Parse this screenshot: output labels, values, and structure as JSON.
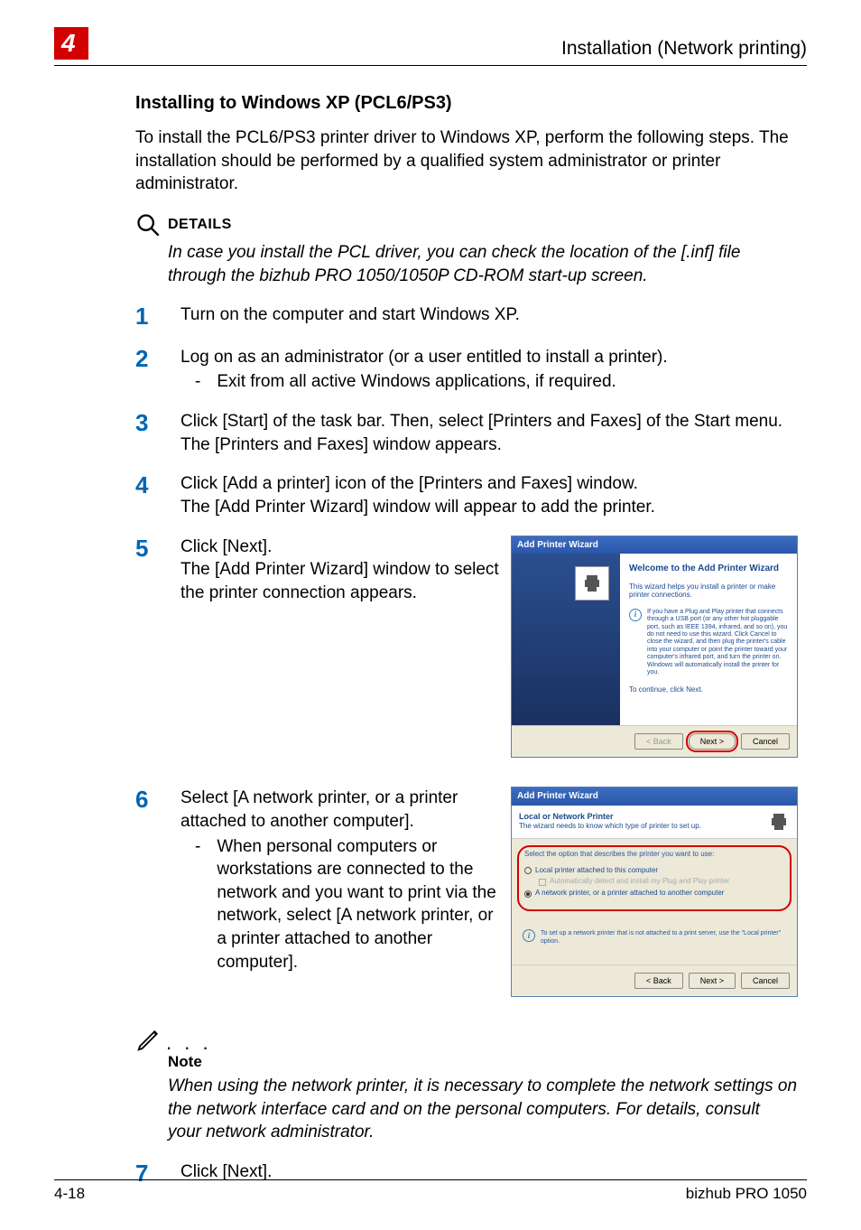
{
  "header": {
    "chapter_number": "4",
    "title": "Installation (Network printing)"
  },
  "section_title": "Installing to Windows XP (PCL6/PS3)",
  "intro_text": "To install the PCL6/PS3 printer driver to Windows XP, perform the following steps. The installation should be performed by a qualified system administrator or printer administrator.",
  "details": {
    "label": "DETAILS",
    "text": "In case you install the PCL driver, you can check the location of the [.inf] file through the bizhub PRO 1050/1050P CD-ROM start-up screen."
  },
  "steps": [
    {
      "n": "1",
      "text": "Turn on the computer and start Windows XP."
    },
    {
      "n": "2",
      "text": "Log on as an administrator (or a user entitled to install a printer).",
      "sub": "Exit from all active Windows applications, if required."
    },
    {
      "n": "3",
      "text": "Click [Start] of the task bar. Then, select [Printers and Faxes] of the Start menu.",
      "after": "The [Printers and Faxes] window appears."
    },
    {
      "n": "4",
      "text": "Click [Add a printer] icon of the [Printers and Faxes] window.",
      "after": "The [Add Printer Wizard] window will appear to add the printer."
    },
    {
      "n": "5",
      "text": "Click [Next].",
      "after": "The [Add Printer Wizard] window to select the printer connection appears."
    },
    {
      "n": "6",
      "text": "Select [A network printer, or a printer attached to another computer].",
      "sub": "When personal computers or workstations are connected to the network and you want to print via the network, select [A network printer, or a printer attached to another computer]."
    },
    {
      "n": "7",
      "text": "Click [Next]."
    }
  ],
  "wizard1": {
    "title": "Add Printer Wizard",
    "welcome": "Welcome to the Add Printer Wizard",
    "sub": "This wizard helps you install a printer or make printer connections.",
    "info": "If you have a Plug and Play printer that connects through a USB port (or any other hot pluggable port, such as IEEE 1394, infrared, and so on), you do not need to use this wizard. Click Cancel to close the wizard, and then plug the printer's cable into your computer or point the printer toward your computer's infrared port, and turn the printer on. Windows will automatically install the printer for you.",
    "cont": "To continue, click Next.",
    "btn_back": "< Back",
    "btn_next": "Next >",
    "btn_cancel": "Cancel"
  },
  "wizard2": {
    "title": "Add Printer Wizard",
    "head_bold": "Local or Network Printer",
    "head_sub": "The wizard needs to know which type of printer to set up.",
    "prompt": "Select the option that describes the printer you want to use:",
    "opt_local": "Local printer attached to this computer",
    "opt_auto": "Automatically detect and install my Plug and Play printer",
    "opt_network": "A network printer, or a printer attached to another computer",
    "tip": "To set up a network printer that is not attached to a print server, use the \"Local printer\" option.",
    "btn_back": "< Back",
    "btn_next": "Next >",
    "btn_cancel": "Cancel"
  },
  "note": {
    "label": "Note",
    "text": "When using the network printer, it is necessary to complete the network settings on the network interface card and on the personal computers. For details, consult your network administrator."
  },
  "footer": {
    "page": "4-18",
    "product": "bizhub PRO 1050"
  }
}
